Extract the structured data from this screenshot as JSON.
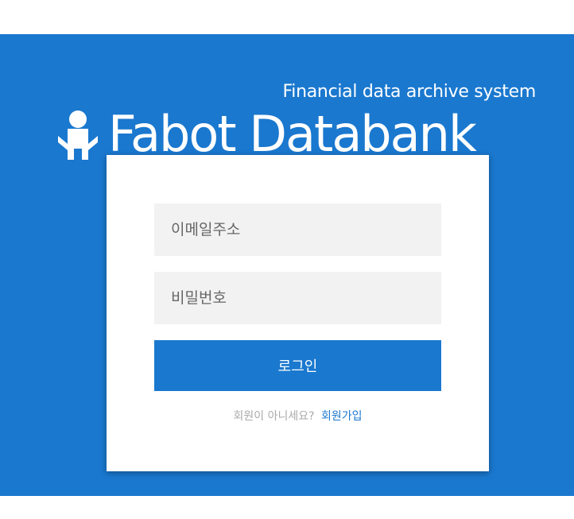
{
  "header": {
    "tagline": "Financial data archive system",
    "title": "Fabot Databank",
    "logo_icon": "robot-icon"
  },
  "login_form": {
    "email_placeholder": "이메일주소",
    "password_placeholder": "비밀번호",
    "login_label": "로그인",
    "signup_prompt": "회원이 아니세요?",
    "signup_link": "회원가입"
  },
  "colors": {
    "brand_blue": "#1a78cf",
    "field_bg": "#f2f2f2",
    "card_bg": "#ffffff"
  }
}
